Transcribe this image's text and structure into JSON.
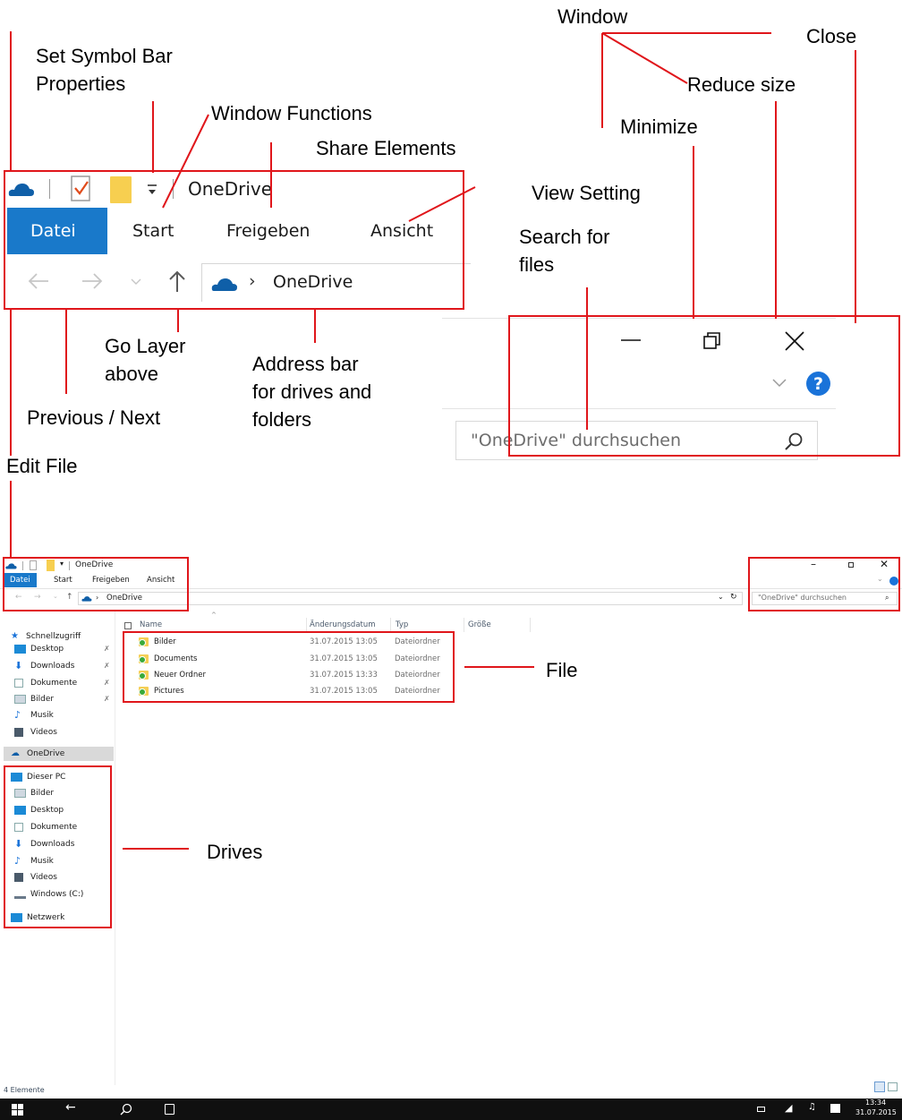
{
  "annotations": {
    "window": "Window",
    "close": "Close",
    "set_symbol_bar_line1": "Set Symbol Bar",
    "set_symbol_bar_line2": "Properties",
    "reduce_size": "Reduce size",
    "window_functions": "Window Functions",
    "minimize": "Minimize",
    "share_elements": "Share Elements",
    "view_setting": "View Setting",
    "search_for_files_line1": "Search for",
    "search_for_files_line2": "files",
    "go_layer_above_line1": "Go Layer",
    "go_layer_above_line2": "above",
    "address_bar_line1": "Address bar",
    "address_bar_line2": "for drives and",
    "address_bar_line3": "folders",
    "previous_next": "Previous / Next",
    "edit_file": "Edit File",
    "file": "File",
    "drives": "Drives"
  },
  "zoom": {
    "title": "OneDrive",
    "tabs": [
      "Datei",
      "Start",
      "Freigeben",
      "Ansicht"
    ],
    "address_separator": "›",
    "address": "OneDrive",
    "search_placeholder": "\"OneDrive\" durchsuchen"
  },
  "explorer": {
    "title": "OneDrive",
    "tabs": [
      "Datei",
      "Start",
      "Freigeben",
      "Ansicht"
    ],
    "address": "OneDrive",
    "search_placeholder": "\"OneDrive\" durchsuchen",
    "columns": [
      "Name",
      "Änderungsdatum",
      "Typ",
      "Größe"
    ],
    "files": [
      {
        "name": "Bilder",
        "date": "31.07.2015 13:05",
        "type": "Dateiordner"
      },
      {
        "name": "Documents",
        "date": "31.07.2015 13:05",
        "type": "Dateiordner"
      },
      {
        "name": "Neuer Ordner",
        "date": "31.07.2015 13:33",
        "type": "Dateiordner"
      },
      {
        "name": "Pictures",
        "date": "31.07.2015 13:05",
        "type": "Dateiordner"
      }
    ],
    "quick_access": "Schnellzugriff",
    "quick_items": [
      "Desktop",
      "Downloads",
      "Dokumente",
      "Bilder",
      "Musik",
      "Videos"
    ],
    "onedrive": "OneDrive",
    "this_pc": "Dieser PC",
    "pc_items": [
      "Bilder",
      "Desktop",
      "Dokumente",
      "Downloads",
      "Musik",
      "Videos",
      "Windows (C:)"
    ],
    "network": "Netzwerk",
    "status": "4 Elemente"
  },
  "taskbar": {
    "time": "13:34",
    "date": "31.07.2015"
  },
  "colors": {
    "annotation_red": "#e0161b",
    "datei_blue": "#1979ca",
    "help_blue": "#1a73d9",
    "onedrive_blue": "#0f5fa8",
    "taskbar": "#101010"
  }
}
